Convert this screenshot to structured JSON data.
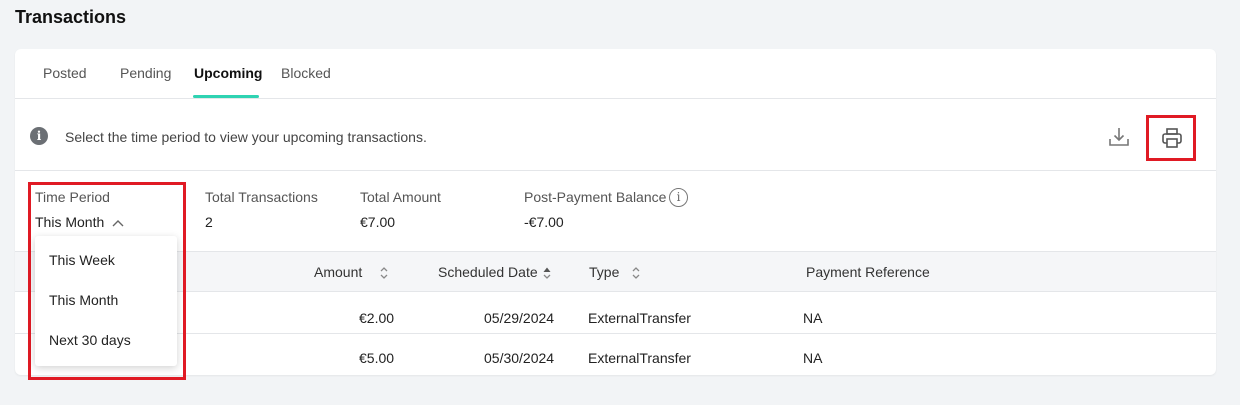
{
  "page": {
    "title": "Transactions"
  },
  "tabs": [
    {
      "label": "Posted"
    },
    {
      "label": "Pending"
    },
    {
      "label": "Upcoming",
      "active": true
    },
    {
      "label": "Blocked"
    }
  ],
  "info": {
    "text": "Select the time period to view your upcoming transactions."
  },
  "icons": {
    "download": "download-icon",
    "print": "printer-icon",
    "info": "info-icon"
  },
  "summary": {
    "time_period": {
      "label": "Time Period",
      "value": "This Month"
    },
    "total_transactions": {
      "label": "Total Transactions",
      "value": "2"
    },
    "total_amount": {
      "label": "Total Amount",
      "value": "€7.00"
    },
    "post_payment_balance": {
      "label": "Post-Payment Balance",
      "value": "-€7.00"
    }
  },
  "dropdown": {
    "options": [
      "This Week",
      "This Month",
      "Next 30 days"
    ]
  },
  "table": {
    "columns": [
      "Amount",
      "Scheduled Date",
      "Type",
      "Payment Reference"
    ],
    "rows": [
      {
        "amount": "€2.00",
        "date": "05/29/2024",
        "type": "ExternalTransfer",
        "reference": "NA"
      },
      {
        "amount": "€5.00",
        "date": "05/30/2024",
        "type": "ExternalTransfer",
        "reference": "NA"
      }
    ]
  },
  "colors": {
    "accent": "#2fd3b2",
    "highlight": "#e01a24"
  }
}
